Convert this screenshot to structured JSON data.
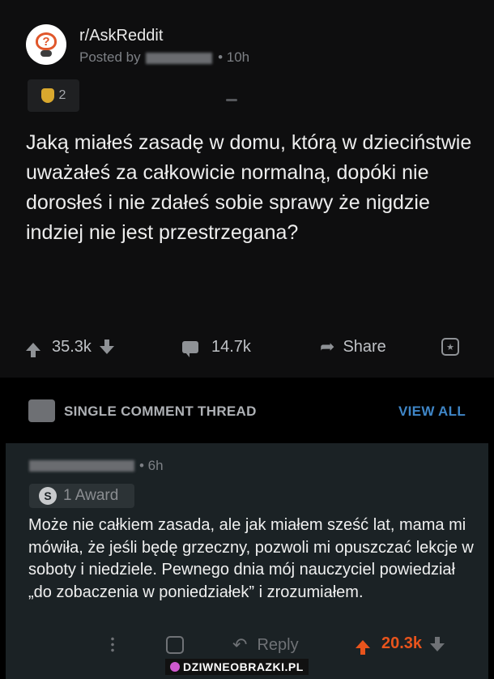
{
  "post": {
    "subreddit": "r/AskReddit",
    "posted_by_prefix": "Posted by",
    "age": "• 10h",
    "award_count": "2",
    "title": "Jaką miałeś zasadę w domu, którą w dzieciństwie uważałeś za całkowicie normalną, dopóki nie dorosłeś i nie zdałeś sobie sprawy że nigdzie indziej nie jest przestrzegana?",
    "score": "35.3k",
    "comments": "14.7k",
    "share_label": "Share"
  },
  "thread_bar": {
    "label": "SINGLE COMMENT THREAD",
    "view_all": "VIEW ALL"
  },
  "comment": {
    "age": "• 6h",
    "award_label": "1 Award",
    "body": "Może nie całkiem zasada, ale jak miałem sześć lat, mama mi mówiła, że jeśli będę grzeczny, pozwoli mi opuszczać lekcje w soboty i niedziele. Pewnego dnia mój nauczyciel powiedział „do zobaczenia w poniedziałek” i zrozumiałem.",
    "reply_label": "Reply",
    "score": "20.3k"
  },
  "watermark": {
    "text": "DZIWNEOBRAZKI.PL"
  },
  "colors": {
    "upvote": "#e8541c",
    "link": "#3f86c7",
    "comment_bg": "#1b2225",
    "post_bg": "#0e0e0f"
  }
}
